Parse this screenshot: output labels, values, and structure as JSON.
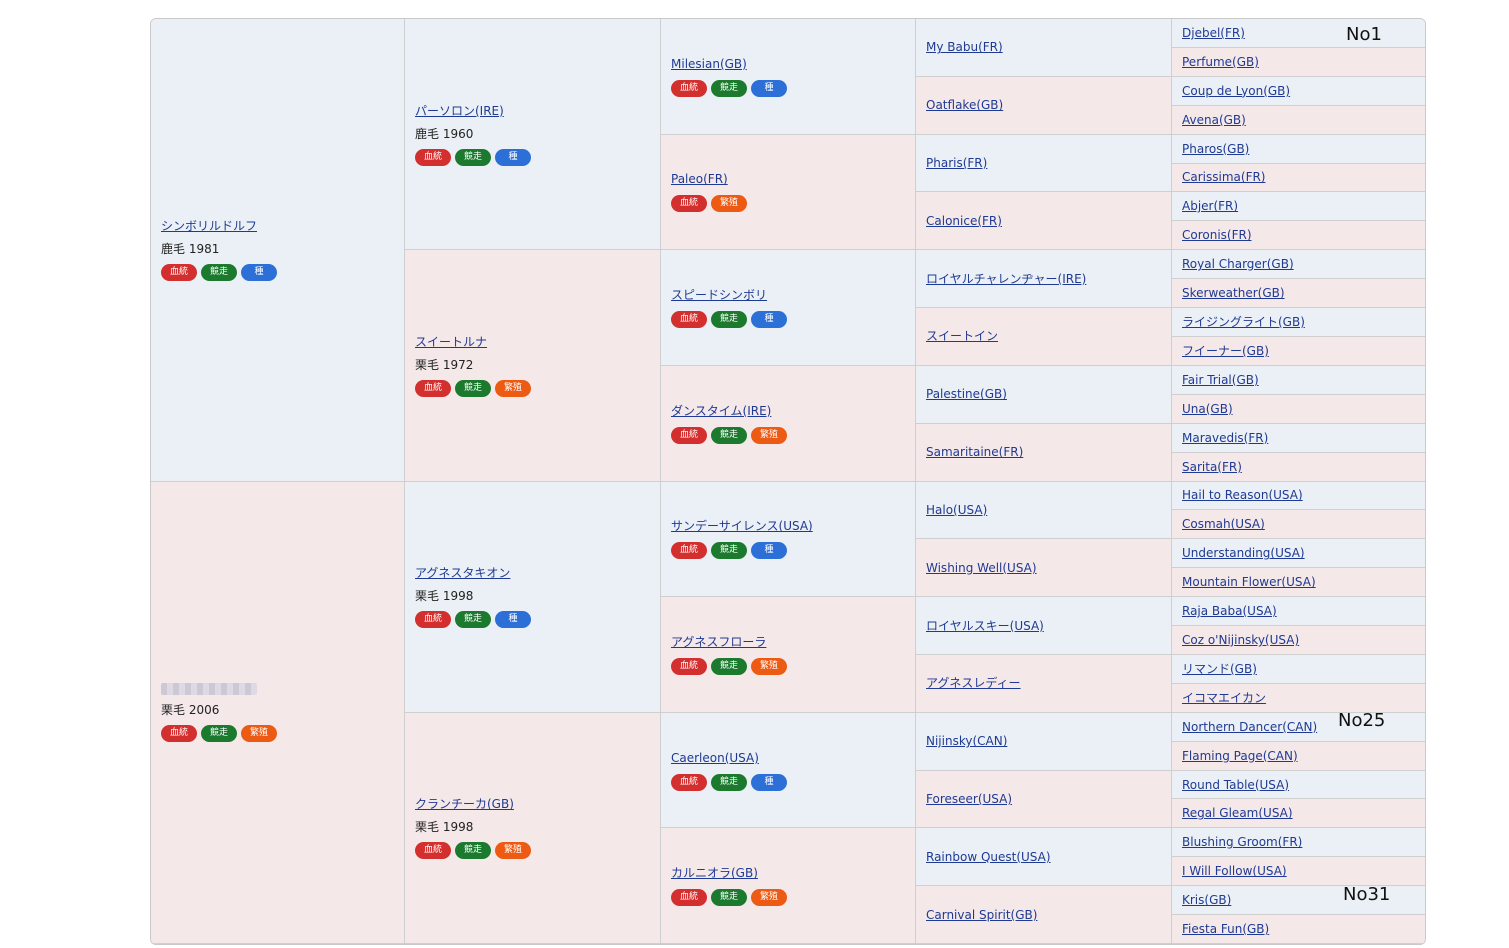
{
  "horses": [
    {
      "col": 1,
      "row": 1,
      "span": 16,
      "side": "sire",
      "name": "シンボリルドルフ",
      "info": "鹿毛 1981",
      "badges": [
        "blood",
        "race",
        "stud"
      ]
    },
    {
      "col": 1,
      "row": 17,
      "span": 16,
      "side": "dam",
      "name": "",
      "blurred": true,
      "info": "栗毛 2006",
      "badges": [
        "blood",
        "race",
        "breed"
      ]
    },
    {
      "col": 2,
      "row": 1,
      "span": 8,
      "side": "sire",
      "name": "パーソロン(IRE)",
      "info": "鹿毛 1960",
      "badges": [
        "blood",
        "race",
        "stud"
      ]
    },
    {
      "col": 2,
      "row": 9,
      "span": 8,
      "side": "dam",
      "name": "スイートルナ",
      "info": "栗毛 1972",
      "badges": [
        "blood",
        "race",
        "breed"
      ]
    },
    {
      "col": 2,
      "row": 17,
      "span": 8,
      "side": "sire",
      "name": "アグネスタキオン",
      "info": "栗毛 1998",
      "badges": [
        "blood",
        "race",
        "stud"
      ]
    },
    {
      "col": 2,
      "row": 25,
      "span": 8,
      "side": "dam",
      "name": "クランチーカ(GB)",
      "info": "栗毛 1998",
      "badges": [
        "blood",
        "race",
        "breed"
      ]
    },
    {
      "col": 3,
      "row": 1,
      "span": 4,
      "side": "sire",
      "name": "Milesian(GB)",
      "badges": [
        "blood",
        "race",
        "stud"
      ]
    },
    {
      "col": 3,
      "row": 5,
      "span": 4,
      "side": "dam",
      "name": "Paleo(FR)",
      "badges": [
        "blood",
        "breed"
      ]
    },
    {
      "col": 3,
      "row": 9,
      "span": 4,
      "side": "sire",
      "name": "スピードシンボリ",
      "badges": [
        "blood",
        "race",
        "stud"
      ]
    },
    {
      "col": 3,
      "row": 13,
      "span": 4,
      "side": "dam",
      "name": "ダンスタイム(IRE)",
      "badges": [
        "blood",
        "race",
        "breed"
      ]
    },
    {
      "col": 3,
      "row": 17,
      "span": 4,
      "side": "sire",
      "name": "サンデーサイレンス(USA)",
      "badges": [
        "blood",
        "race",
        "stud"
      ]
    },
    {
      "col": 3,
      "row": 21,
      "span": 4,
      "side": "dam",
      "name": "アグネスフローラ",
      "badges": [
        "blood",
        "race",
        "breed"
      ]
    },
    {
      "col": 3,
      "row": 25,
      "span": 4,
      "side": "sire",
      "name": "Caerleon(USA)",
      "badges": [
        "blood",
        "race",
        "stud"
      ]
    },
    {
      "col": 3,
      "row": 29,
      "span": 4,
      "side": "dam",
      "name": "カルニオラ(GB)",
      "badges": [
        "blood",
        "race",
        "breed"
      ]
    },
    {
      "col": 4,
      "row": 1,
      "span": 2,
      "side": "sire",
      "name": "My Babu(FR)"
    },
    {
      "col": 4,
      "row": 3,
      "span": 2,
      "side": "dam",
      "name": "Oatflake(GB)"
    },
    {
      "col": 4,
      "row": 5,
      "span": 2,
      "side": "sire",
      "name": "Pharis(FR)"
    },
    {
      "col": 4,
      "row": 7,
      "span": 2,
      "side": "dam",
      "name": "Calonice(FR)"
    },
    {
      "col": 4,
      "row": 9,
      "span": 2,
      "side": "sire",
      "name": "ロイヤルチャレンヂャー(IRE)"
    },
    {
      "col": 4,
      "row": 11,
      "span": 2,
      "side": "dam",
      "name": "スイートイン"
    },
    {
      "col": 4,
      "row": 13,
      "span": 2,
      "side": "sire",
      "name": "Palestine(GB)"
    },
    {
      "col": 4,
      "row": 15,
      "span": 2,
      "side": "dam",
      "name": "Samaritaine(FR)"
    },
    {
      "col": 4,
      "row": 17,
      "span": 2,
      "side": "sire",
      "name": "Halo(USA)"
    },
    {
      "col": 4,
      "row": 19,
      "span": 2,
      "side": "dam",
      "name": "Wishing Well(USA)"
    },
    {
      "col": 4,
      "row": 21,
      "span": 2,
      "side": "sire",
      "name": "ロイヤルスキー(USA)"
    },
    {
      "col": 4,
      "row": 23,
      "span": 2,
      "side": "dam",
      "name": "アグネスレディー"
    },
    {
      "col": 4,
      "row": 25,
      "span": 2,
      "side": "sire",
      "name": "Nijinsky(CAN)"
    },
    {
      "col": 4,
      "row": 27,
      "span": 2,
      "side": "dam",
      "name": "Foreseer(USA)"
    },
    {
      "col": 4,
      "row": 29,
      "span": 2,
      "side": "sire",
      "name": "Rainbow Quest(USA)"
    },
    {
      "col": 4,
      "row": 31,
      "span": 2,
      "side": "dam",
      "name": "Carnival Spirit(GB)"
    },
    {
      "col": 5,
      "row": 1,
      "span": 1,
      "side": "sire",
      "name": "Djebel(FR)"
    },
    {
      "col": 5,
      "row": 2,
      "span": 1,
      "side": "dam",
      "name": "Perfume(GB)"
    },
    {
      "col": 5,
      "row": 3,
      "span": 1,
      "side": "sire",
      "name": "Coup de Lyon(GB)"
    },
    {
      "col": 5,
      "row": 4,
      "span": 1,
      "side": "dam",
      "name": "Avena(GB)"
    },
    {
      "col": 5,
      "row": 5,
      "span": 1,
      "side": "sire",
      "name": "Pharos(GB)"
    },
    {
      "col": 5,
      "row": 6,
      "span": 1,
      "side": "dam",
      "name": "Carissima(FR)"
    },
    {
      "col": 5,
      "row": 7,
      "span": 1,
      "side": "sire",
      "name": "Abjer(FR)"
    },
    {
      "col": 5,
      "row": 8,
      "span": 1,
      "side": "dam",
      "name": "Coronis(FR)"
    },
    {
      "col": 5,
      "row": 9,
      "span": 1,
      "side": "sire",
      "name": "Royal Charger(GB)"
    },
    {
      "col": 5,
      "row": 10,
      "span": 1,
      "side": "dam",
      "name": "Skerweather(GB)"
    },
    {
      "col": 5,
      "row": 11,
      "span": 1,
      "side": "sire",
      "name": "ライジングライト(GB)"
    },
    {
      "col": 5,
      "row": 12,
      "span": 1,
      "side": "dam",
      "name": "フイーナー(GB)"
    },
    {
      "col": 5,
      "row": 13,
      "span": 1,
      "side": "sire",
      "name": "Fair Trial(GB)"
    },
    {
      "col": 5,
      "row": 14,
      "span": 1,
      "side": "dam",
      "name": "Una(GB)"
    },
    {
      "col": 5,
      "row": 15,
      "span": 1,
      "side": "sire",
      "name": "Maravedis(FR)"
    },
    {
      "col": 5,
      "row": 16,
      "span": 1,
      "side": "dam",
      "name": "Sarita(FR)"
    },
    {
      "col": 5,
      "row": 17,
      "span": 1,
      "side": "sire",
      "name": "Hail to Reason(USA)"
    },
    {
      "col": 5,
      "row": 18,
      "span": 1,
      "side": "dam",
      "name": "Cosmah(USA)"
    },
    {
      "col": 5,
      "row": 19,
      "span": 1,
      "side": "sire",
      "name": "Understanding(USA)"
    },
    {
      "col": 5,
      "row": 20,
      "span": 1,
      "side": "dam",
      "name": "Mountain Flower(USA)"
    },
    {
      "col": 5,
      "row": 21,
      "span": 1,
      "side": "sire",
      "name": "Raja Baba(USA)"
    },
    {
      "col": 5,
      "row": 22,
      "span": 1,
      "side": "dam",
      "name": "Coz o'Nijinsky(USA)"
    },
    {
      "col": 5,
      "row": 23,
      "span": 1,
      "side": "sire",
      "name": "リマンド(GB)"
    },
    {
      "col": 5,
      "row": 24,
      "span": 1,
      "side": "dam",
      "name": "イコマエイカン"
    },
    {
      "col": 5,
      "row": 25,
      "span": 1,
      "side": "sire",
      "name": "Northern Dancer(CAN)"
    },
    {
      "col": 5,
      "row": 26,
      "span": 1,
      "side": "dam",
      "name": "Flaming Page(CAN)"
    },
    {
      "col": 5,
      "row": 27,
      "span": 1,
      "side": "sire",
      "name": "Round Table(USA)"
    },
    {
      "col": 5,
      "row": 28,
      "span": 1,
      "side": "dam",
      "name": "Regal Gleam(USA)"
    },
    {
      "col": 5,
      "row": 29,
      "span": 1,
      "side": "sire",
      "name": "Blushing Groom(FR)"
    },
    {
      "col": 5,
      "row": 30,
      "span": 1,
      "side": "dam",
      "name": "I Will Follow(USA)"
    },
    {
      "col": 5,
      "row": 31,
      "span": 1,
      "side": "sire",
      "name": "Kris(GB)"
    },
    {
      "col": 5,
      "row": 32,
      "span": 1,
      "side": "dam",
      "name": "Fiesta Fun(GB)"
    }
  ],
  "badge_labels": {
    "blood": "血統",
    "race": "競走",
    "stud": "種",
    "breed": "繁殖"
  },
  "badge_colors": {
    "blood": "#d32f2f",
    "race": "#1b7a2e",
    "stud": "#2c6fd6",
    "breed": "#ec5a13"
  },
  "annotations": {
    "no1": "No1",
    "no25": "No25",
    "no31": "No31"
  }
}
